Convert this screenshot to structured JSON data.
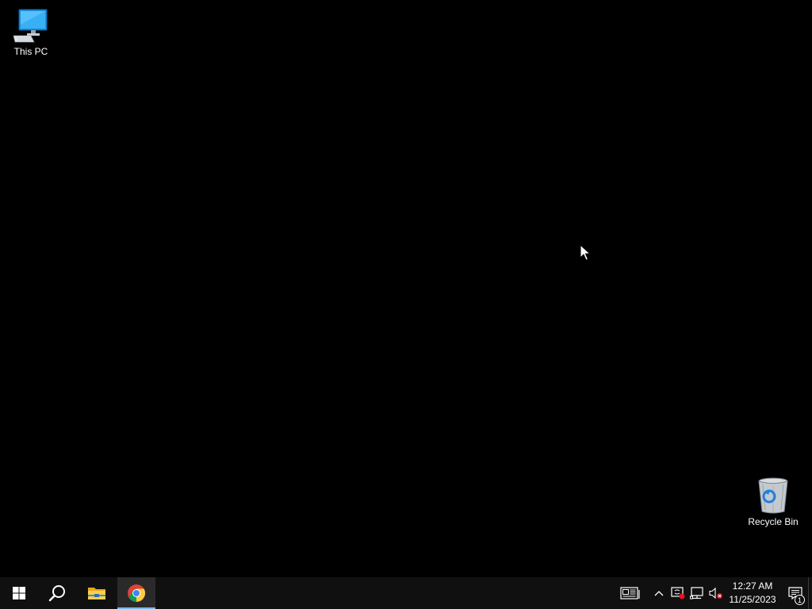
{
  "desktop": {
    "background_color": "#000000",
    "icons": [
      {
        "label": "This PC",
        "icon": "this-pc-icon"
      },
      {
        "label": "Recycle Bin",
        "icon": "recycle-bin-icon"
      }
    ]
  },
  "taskbar": {
    "background_color": "#101010",
    "accent_color": "#76b9ed",
    "pinned": [
      {
        "name": "Start",
        "icon": "windows-logo-icon",
        "active": false
      },
      {
        "name": "Search",
        "icon": "search-icon",
        "active": false
      },
      {
        "name": "File Explorer",
        "icon": "folder-icon",
        "active": false
      },
      {
        "name": "Google Chrome",
        "icon": "chrome-icon",
        "active": true
      }
    ],
    "tray": {
      "icons": [
        "news-and-interests-icon",
        "chevron-up-icon",
        "security-warning-icon",
        "network-icon",
        "volume-muted-icon"
      ],
      "clock": {
        "time": "12:27 AM",
        "date": "11/25/2023"
      },
      "notifications": {
        "icon": "action-center-icon",
        "count": "1"
      }
    }
  }
}
